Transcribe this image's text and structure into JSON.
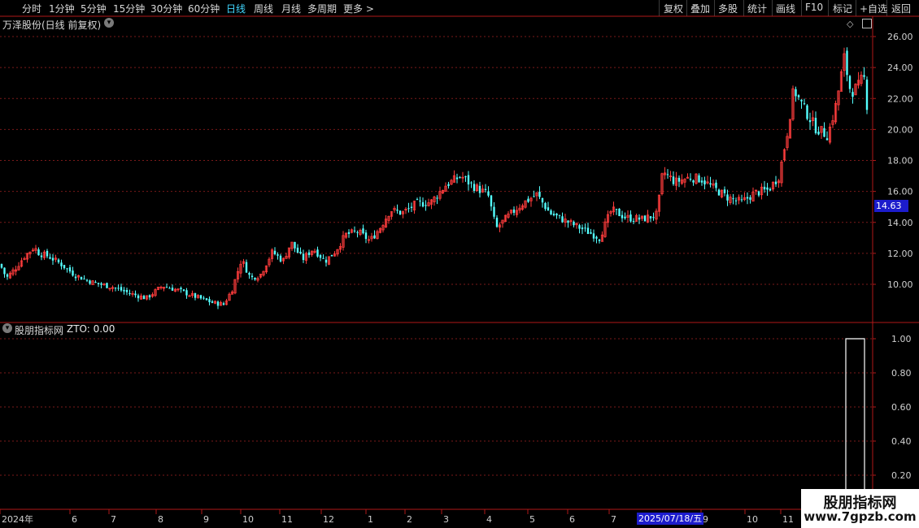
{
  "toolbar": {
    "left_items": [
      "分时",
      "1分钟",
      "5分钟",
      "15分钟",
      "30分钟",
      "60分钟",
      "日线",
      "周线",
      "月线",
      "多周期",
      "更多 >"
    ],
    "active_item": "日线",
    "right_items": [
      "复权",
      "叠加",
      "多股",
      "统计",
      "画线",
      "F10",
      "标记",
      "+自选",
      "返回"
    ]
  },
  "price_panel": {
    "title": "万泽股份(日线 前复权)",
    "y_ticks": [
      "26.00",
      "24.00",
      "22.00",
      "20.00",
      "18.00",
      "16.00",
      "14.00",
      "12.00",
      "10.00"
    ],
    "current_price": "14.63"
  },
  "indicator_panel": {
    "title": "股朋指标网",
    "series_label": "ZTO: 0.00",
    "y_ticks": [
      "1.00",
      "0.80",
      "0.60",
      "0.40",
      "0.20"
    ]
  },
  "x_axis": {
    "labels": [
      "2024年",
      "6",
      "7",
      "8",
      "9",
      "10",
      "11",
      "12",
      "1",
      "2",
      "3",
      "4",
      "5",
      "6",
      "7",
      "9",
      "10",
      "11"
    ],
    "cursor_date": "2025/07/18/五"
  },
  "brand": {
    "title": "股朋指标网",
    "url": "www.7gpzb.com"
  },
  "colors": {
    "up": "#ff3c3c",
    "down": "#54ffff",
    "axis": "#b01818",
    "grid": "#7a1a1a",
    "active": "#41d7ff",
    "badge": "#1c1ccc"
  },
  "chart_data": {
    "type": "candlestick",
    "y_range": [
      8.0,
      26.8
    ],
    "closes_anchor": [
      [
        0,
        11.3
      ],
      [
        8,
        10.4
      ],
      [
        20,
        11.1
      ],
      [
        30,
        11.8
      ],
      [
        42,
        12.4
      ],
      [
        48,
        12.0
      ],
      [
        60,
        11.8
      ],
      [
        75,
        11.3
      ],
      [
        92,
        10.6
      ],
      [
        115,
        10.1
      ],
      [
        140,
        9.8
      ],
      [
        160,
        9.4
      ],
      [
        180,
        9.1
      ],
      [
        200,
        9.9
      ],
      [
        220,
        9.6
      ],
      [
        240,
        9.2
      ],
      [
        262,
        8.8
      ],
      [
        275,
        8.7
      ],
      [
        285,
        9.6
      ],
      [
        297,
        11.6
      ],
      [
        308,
        10.4
      ],
      [
        320,
        10.6
      ],
      [
        335,
        12.1
      ],
      [
        348,
        11.5
      ],
      [
        358,
        12.7
      ],
      [
        372,
        11.6
      ],
      [
        385,
        12.3
      ],
      [
        400,
        11.5
      ],
      [
        412,
        12.1
      ],
      [
        425,
        13.2
      ],
      [
        440,
        13.4
      ],
      [
        455,
        12.8
      ],
      [
        468,
        13.7
      ],
      [
        480,
        14.8
      ],
      [
        495,
        14.6
      ],
      [
        512,
        15.2
      ],
      [
        530,
        15.3
      ],
      [
        548,
        16.4
      ],
      [
        567,
        17.0
      ],
      [
        580,
        16.4
      ],
      [
        600,
        15.8
      ],
      [
        610,
        13.6
      ],
      [
        625,
        14.4
      ],
      [
        642,
        15.2
      ],
      [
        660,
        15.8
      ],
      [
        676,
        14.6
      ],
      [
        695,
        14.1
      ],
      [
        715,
        13.6
      ],
      [
        737,
        13.0
      ],
      [
        752,
        14.8
      ],
      [
        770,
        14.3
      ],
      [
        790,
        14.2
      ],
      [
        808,
        14.5
      ],
      [
        815,
        17.3
      ],
      [
        830,
        16.6
      ],
      [
        848,
        16.9
      ],
      [
        862,
        16.8
      ],
      [
        875,
        16.3
      ],
      [
        895,
        15.6
      ],
      [
        912,
        15.3
      ],
      [
        928,
        15.9
      ],
      [
        945,
        16.1
      ],
      [
        958,
        17.0
      ],
      [
        968,
        19.8
      ],
      [
        976,
        22.6
      ],
      [
        988,
        21.4
      ],
      [
        1003,
        20.1
      ],
      [
        1018,
        19.6
      ],
      [
        1028,
        21.6
      ],
      [
        1038,
        24.6
      ],
      [
        1046,
        22.4
      ],
      [
        1056,
        22.8
      ],
      [
        1062,
        23.5
      ],
      [
        1066,
        21.6
      ]
    ],
    "indicator": [
      {
        "x_start": 1040,
        "x_end": 1063,
        "value": 1.0
      }
    ],
    "indicator_range": [
      0.1,
      1.08
    ]
  }
}
